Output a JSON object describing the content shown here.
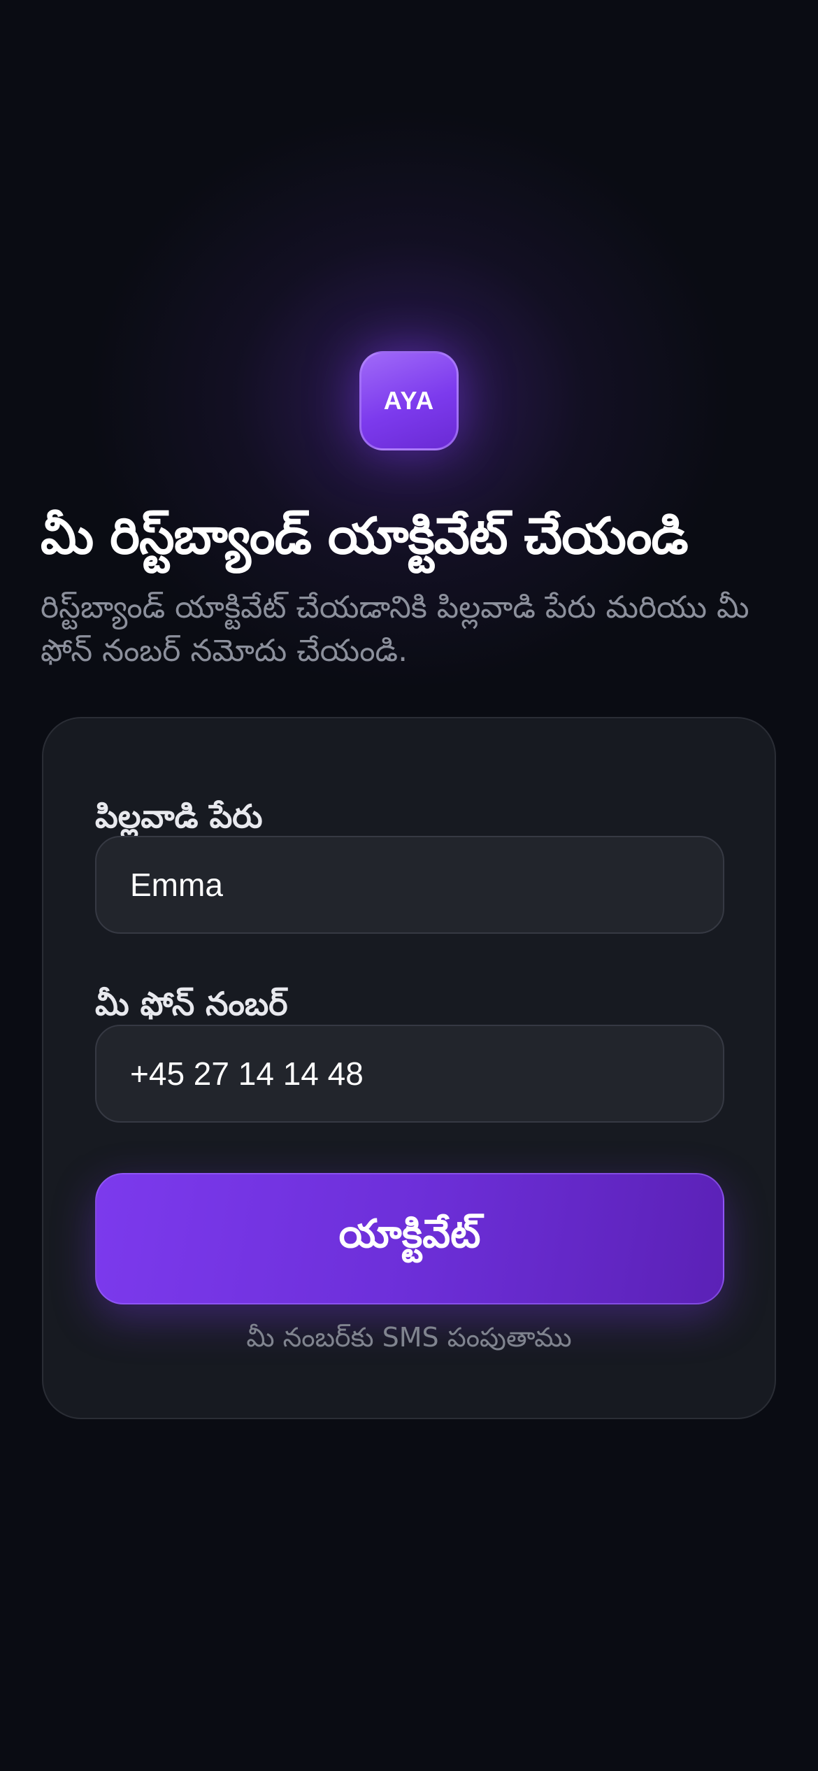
{
  "logo": {
    "text": "AYA"
  },
  "header": {
    "title": "మీ రిస్ట్‌బ్యాండ్ యాక్టివేట్ చేయండి",
    "subtitle": "రిస్ట్‌బ్యాండ్ యాక్టివేట్ చేయడానికి పిల్లవాడి పేరు మరియు మీ ఫోన్ నంబర్ నమోదు చేయండి."
  },
  "form": {
    "child_name": {
      "label": "పిల్లవాడి పేరు",
      "value": "Emma"
    },
    "phone": {
      "label": "మీ ఫోన్ నంబర్",
      "value": "+45 27 14 14 48"
    },
    "submit_label": "యాక్టివేట్",
    "hint": "మీ నంబర్‌కు SMS పంపుతాము"
  },
  "colors": {
    "background": "#0a0c13",
    "card": "#171a21",
    "input": "#22252c",
    "accent": "#7c3aed",
    "accent_dark": "#5b21b6",
    "muted_text": "#8c909c"
  }
}
